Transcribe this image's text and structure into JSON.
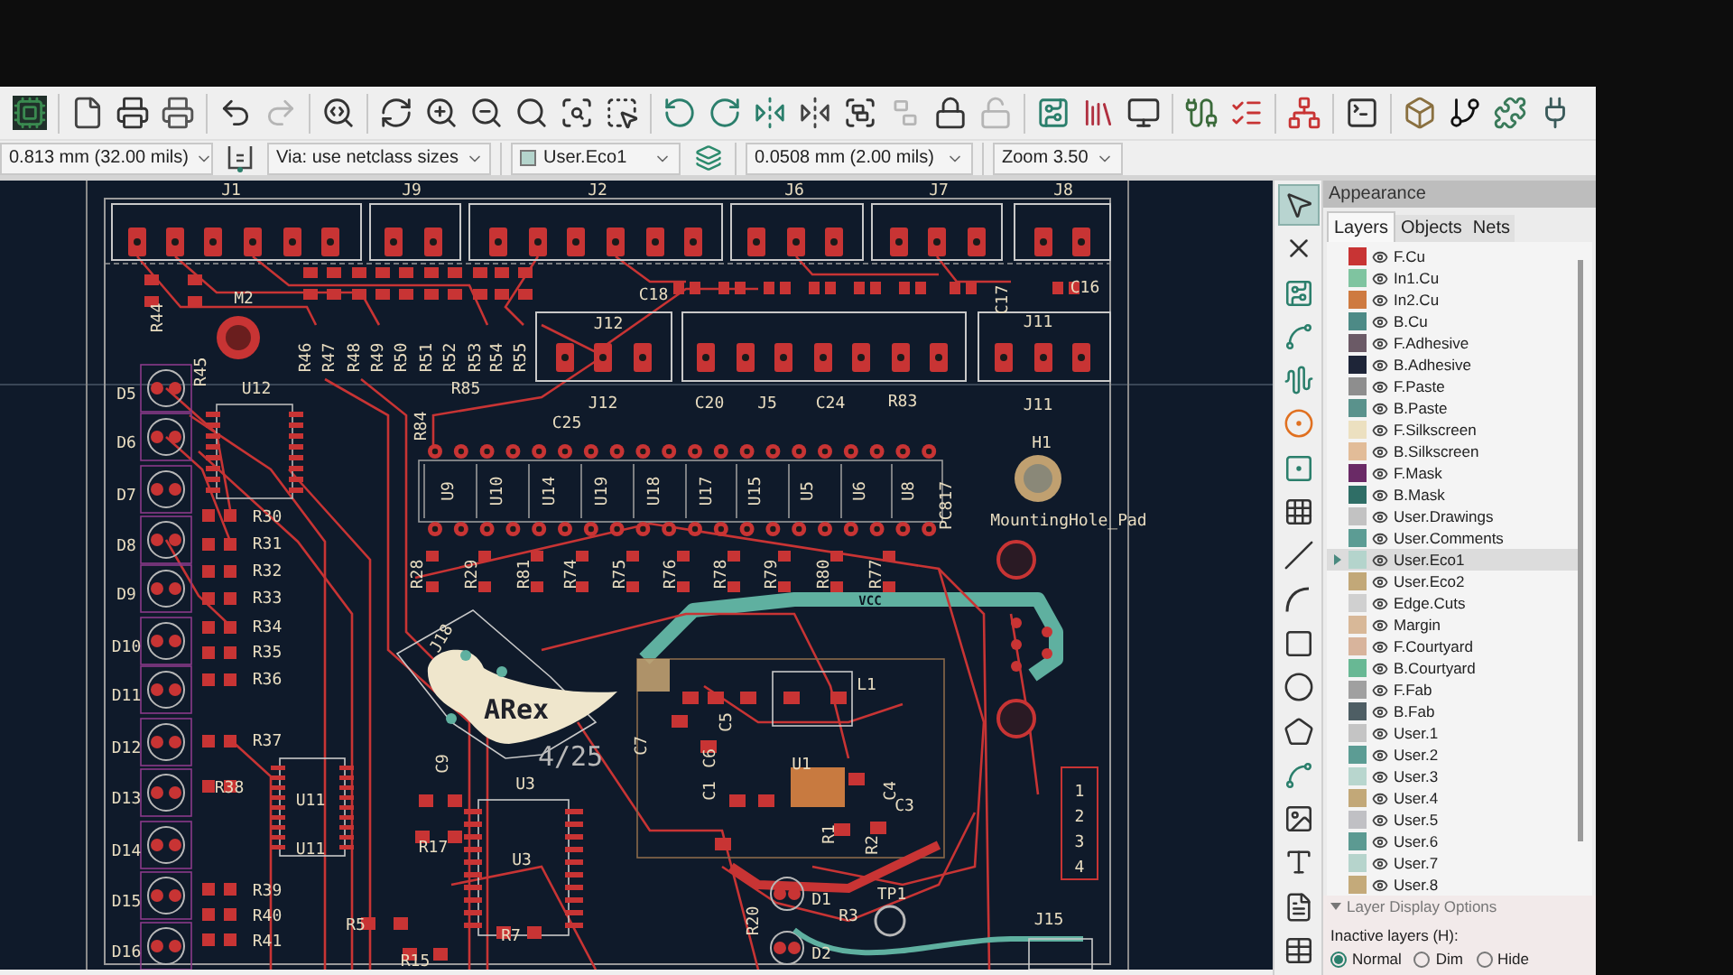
{
  "top_toolbar": [
    {
      "kind": "board-setup",
      "disabled": false
    },
    {
      "kind": "page",
      "disabled": false
    },
    {
      "kind": "print",
      "disabled": false
    },
    {
      "kind": "plot",
      "disabled": false
    },
    {
      "kind": "undo",
      "disabled": false
    },
    {
      "kind": "redo",
      "disabled": true
    },
    {
      "kind": "find",
      "disabled": false
    },
    {
      "kind": "redraw",
      "disabled": false
    },
    {
      "kind": "zoom-in",
      "disabled": false
    },
    {
      "kind": "zoom-out",
      "disabled": false
    },
    {
      "kind": "zoom-fit",
      "disabled": false
    },
    {
      "kind": "zoom-objects",
      "disabled": false
    },
    {
      "kind": "zoom-select",
      "disabled": false
    },
    {
      "kind": "rotate-ccw",
      "disabled": false
    },
    {
      "kind": "rotate-cw",
      "disabled": false
    },
    {
      "kind": "flip",
      "disabled": false
    },
    {
      "kind": "mirror",
      "disabled": false
    },
    {
      "kind": "group",
      "disabled": false
    },
    {
      "kind": "ungroup",
      "disabled": true
    },
    {
      "kind": "lock",
      "disabled": false
    },
    {
      "kind": "unlock",
      "disabled": true
    },
    {
      "kind": "footprint-editor",
      "disabled": false
    },
    {
      "kind": "footprint-browser",
      "disabled": false
    },
    {
      "kind": "board-stackup",
      "disabled": false
    },
    {
      "kind": "update-pcb",
      "disabled": false
    },
    {
      "kind": "drc",
      "disabled": false
    },
    {
      "kind": "net-inspector",
      "disabled": false
    },
    {
      "kind": "console",
      "disabled": false
    },
    {
      "kind": "viewer-3d",
      "disabled": false
    },
    {
      "kind": "git",
      "disabled": false
    },
    {
      "kind": "plugin",
      "disabled": false
    },
    {
      "kind": "export",
      "disabled": false
    }
  ],
  "options_bar": {
    "track_width": "0.813 mm (32.00 mils)",
    "via_size": "Via: use netclass sizes",
    "layer": {
      "name": "User.Eco1",
      "color": "#b4d4cc"
    },
    "grid": "0.0508 mm (2.00 mils)",
    "zoom": "Zoom 3.50"
  },
  "right_toolbar": [
    {
      "kind": "select",
      "selected": true
    },
    {
      "kind": "ratsnest",
      "selected": false
    },
    {
      "kind": "footprint",
      "selected": false
    },
    {
      "kind": "route",
      "selected": false
    },
    {
      "kind": "tune",
      "selected": false
    },
    {
      "kind": "via",
      "selected": false
    },
    {
      "kind": "pad",
      "selected": false
    },
    {
      "kind": "zone",
      "selected": false
    },
    {
      "kind": "line",
      "selected": false
    },
    {
      "kind": "arc",
      "selected": false
    },
    {
      "kind": "rectangle",
      "selected": false
    },
    {
      "kind": "circle",
      "selected": false
    },
    {
      "kind": "polygon",
      "selected": false
    },
    {
      "kind": "bezier",
      "selected": false
    },
    {
      "kind": "image",
      "selected": false
    },
    {
      "kind": "text",
      "selected": false
    },
    {
      "kind": "textbox",
      "selected": false
    },
    {
      "kind": "table",
      "selected": false
    }
  ],
  "appearance": {
    "title": "Appearance",
    "tabs": [
      {
        "label": "Layers",
        "selected": true
      },
      {
        "label": "Objects",
        "selected": false
      },
      {
        "label": "Nets",
        "selected": false
      }
    ],
    "layers": [
      {
        "name": "F.Cu",
        "color": "#c83434",
        "selected": false
      },
      {
        "name": "In1.Cu",
        "color": "#7fc4a0",
        "selected": false
      },
      {
        "name": "In2.Cu",
        "color": "#ce7a40",
        "selected": false
      },
      {
        "name": "B.Cu",
        "color": "#4d8a86",
        "selected": false
      },
      {
        "name": "F.Adhesive",
        "color": "#6b5a66",
        "selected": false
      },
      {
        "name": "B.Adhesive",
        "color": "#1e2538",
        "selected": false
      },
      {
        "name": "F.Paste",
        "color": "#8e8e8e",
        "selected": false
      },
      {
        "name": "B.Paste",
        "color": "#5a928c",
        "selected": false
      },
      {
        "name": "F.Silkscreen",
        "color": "#ece0c0",
        "selected": false
      },
      {
        "name": "B.Silkscreen",
        "color": "#e2bc98",
        "selected": false
      },
      {
        "name": "F.Mask",
        "color": "#6a2a66",
        "selected": false
      },
      {
        "name": "B.Mask",
        "color": "#2f6e66",
        "selected": false
      },
      {
        "name": "User.Drawings",
        "color": "#c2c2c2",
        "selected": false
      },
      {
        "name": "User.Comments",
        "color": "#5c9c94",
        "selected": false
      },
      {
        "name": "User.Eco1",
        "color": "#b4d4cc",
        "selected": true
      },
      {
        "name": "User.Eco2",
        "color": "#c2a878",
        "selected": false
      },
      {
        "name": "Edge.Cuts",
        "color": "#d0d0d0",
        "selected": false
      },
      {
        "name": "Margin",
        "color": "#d8b898",
        "selected": false
      },
      {
        "name": "F.Courtyard",
        "color": "#d8b49c",
        "selected": false
      },
      {
        "name": "B.Courtyard",
        "color": "#68b894",
        "selected": false
      },
      {
        "name": "F.Fab",
        "color": "#a0a0a0",
        "selected": false
      },
      {
        "name": "B.Fab",
        "color": "#4e5e64",
        "selected": false
      },
      {
        "name": "User.1",
        "color": "#c4c4c4",
        "selected": false
      },
      {
        "name": "User.2",
        "color": "#5c9c94",
        "selected": false
      },
      {
        "name": "User.3",
        "color": "#b8d6ce",
        "selected": false
      },
      {
        "name": "User.4",
        "color": "#c2a878",
        "selected": false
      },
      {
        "name": "User.5",
        "color": "#c0c0c4",
        "selected": false
      },
      {
        "name": "User.6",
        "color": "#5c9a92",
        "selected": false
      },
      {
        "name": "User.7",
        "color": "#b6d4cc",
        "selected": false
      },
      {
        "name": "User.8",
        "color": "#c4aa7a",
        "selected": false
      }
    ],
    "display_options": {
      "title": "Layer Display Options",
      "inactive_label": "Inactive layers (H):",
      "options": [
        {
          "label": "Normal",
          "selected": true
        },
        {
          "label": "Dim",
          "selected": false
        },
        {
          "label": "Hide",
          "selected": false
        }
      ]
    }
  },
  "board": {
    "labels": [
      {
        "text": "J1",
        "kind": "ref"
      },
      {
        "text": "J9",
        "kind": "ref"
      },
      {
        "text": "J2",
        "kind": "ref"
      },
      {
        "text": "J6",
        "kind": "ref"
      },
      {
        "text": "J7",
        "kind": "ref"
      },
      {
        "text": "J8",
        "kind": "ref"
      },
      {
        "text": "M2",
        "kind": "ref"
      },
      {
        "text": "R44",
        "kind": "ref"
      },
      {
        "text": "R45",
        "kind": "ref"
      },
      {
        "text": "R46",
        "kind": "ref"
      },
      {
        "text": "R47",
        "kind": "ref"
      },
      {
        "text": "R48",
        "kind": "ref"
      },
      {
        "text": "R49",
        "kind": "ref"
      },
      {
        "text": "R50",
        "kind": "ref"
      },
      {
        "text": "R51",
        "kind": "ref"
      },
      {
        "text": "R52",
        "kind": "ref"
      },
      {
        "text": "R53",
        "kind": "ref"
      },
      {
        "text": "R54",
        "kind": "ref"
      },
      {
        "text": "R55",
        "kind": "ref"
      },
      {
        "text": "C18",
        "kind": "ref"
      },
      {
        "text": "C16",
        "kind": "ref"
      },
      {
        "text": "C17",
        "kind": "ref"
      },
      {
        "text": "J12",
        "kind": "ref"
      },
      {
        "text": "J11",
        "kind": "ref"
      },
      {
        "text": "R85",
        "kind": "ref"
      },
      {
        "text": "R84",
        "kind": "ref"
      },
      {
        "text": "J12",
        "kind": "ref"
      },
      {
        "text": "C20",
        "kind": "ref"
      },
      {
        "text": "J5",
        "kind": "ref"
      },
      {
        "text": "C24",
        "kind": "ref"
      },
      {
        "text": "R83",
        "kind": "ref"
      },
      {
        "text": "J11",
        "kind": "ref"
      },
      {
        "text": "C25",
        "kind": "ref"
      },
      {
        "text": "U12",
        "kind": "ref"
      },
      {
        "text": "H1",
        "kind": "ref"
      },
      {
        "text": "MountingHole_Pad",
        "kind": "ref"
      },
      {
        "text": "D5",
        "kind": "ref"
      },
      {
        "text": "D6",
        "kind": "ref"
      },
      {
        "text": "D7",
        "kind": "ref"
      },
      {
        "text": "D8",
        "kind": "ref"
      },
      {
        "text": "D9",
        "kind": "ref"
      },
      {
        "text": "D10",
        "kind": "ref"
      },
      {
        "text": "D11",
        "kind": "ref"
      },
      {
        "text": "D12",
        "kind": "ref"
      },
      {
        "text": "D13",
        "kind": "ref"
      },
      {
        "text": "D14",
        "kind": "ref"
      },
      {
        "text": "D15",
        "kind": "ref"
      },
      {
        "text": "D16",
        "kind": "ref"
      },
      {
        "text": "R30",
        "kind": "ref"
      },
      {
        "text": "R31",
        "kind": "ref"
      },
      {
        "text": "R32",
        "kind": "ref"
      },
      {
        "text": "R33",
        "kind": "ref"
      },
      {
        "text": "R34",
        "kind": "ref"
      },
      {
        "text": "R35",
        "kind": "ref"
      },
      {
        "text": "R36",
        "kind": "ref"
      },
      {
        "text": "R37",
        "kind": "ref"
      },
      {
        "text": "R38",
        "kind": "ref"
      },
      {
        "text": "R39",
        "kind": "ref"
      },
      {
        "text": "R40",
        "kind": "ref"
      },
      {
        "text": "R41",
        "kind": "ref"
      },
      {
        "text": "U9",
        "kind": "ref"
      },
      {
        "text": "U10",
        "kind": "ref"
      },
      {
        "text": "U14",
        "kind": "ref"
      },
      {
        "text": "U19",
        "kind": "ref"
      },
      {
        "text": "U18",
        "kind": "ref"
      },
      {
        "text": "U17",
        "kind": "ref"
      },
      {
        "text": "U15",
        "kind": "ref"
      },
      {
        "text": "U5",
        "kind": "ref"
      },
      {
        "text": "U6",
        "kind": "ref"
      },
      {
        "text": "U8",
        "kind": "ref"
      },
      {
        "text": "PC817",
        "kind": "ref"
      },
      {
        "text": "R28",
        "kind": "ref"
      },
      {
        "text": "R29",
        "kind": "ref"
      },
      {
        "text": "R81",
        "kind": "ref"
      },
      {
        "text": "R74",
        "kind": "ref"
      },
      {
        "text": "R75",
        "kind": "ref"
      },
      {
        "text": "R76",
        "kind": "ref"
      },
      {
        "text": "R78",
        "kind": "ref"
      },
      {
        "text": "R79",
        "kind": "ref"
      },
      {
        "text": "R80",
        "kind": "ref"
      },
      {
        "text": "R77",
        "kind": "ref"
      },
      {
        "text": "VCC",
        "kind": "net"
      },
      {
        "text": "J18",
        "kind": "ref"
      },
      {
        "text": "ARex",
        "kind": "logo"
      },
      {
        "text": "4/25",
        "kind": "big"
      },
      {
        "text": "U3",
        "kind": "ref"
      },
      {
        "text": "U3",
        "kind": "ref"
      },
      {
        "text": "U11",
        "kind": "ref"
      },
      {
        "text": "U11",
        "kind": "ref"
      },
      {
        "text": "C9",
        "kind": "ref"
      },
      {
        "text": "R17",
        "kind": "ref"
      },
      {
        "text": "U1",
        "kind": "ref"
      },
      {
        "text": "L1",
        "kind": "ref"
      },
      {
        "text": "C3",
        "kind": "ref"
      },
      {
        "text": "C4",
        "kind": "ref"
      },
      {
        "text": "C7",
        "kind": "ref"
      },
      {
        "text": "C5",
        "kind": "ref"
      },
      {
        "text": "C6",
        "kind": "ref"
      },
      {
        "text": "C1",
        "kind": "ref"
      },
      {
        "text": "R5",
        "kind": "ref"
      },
      {
        "text": "R7",
        "kind": "ref"
      },
      {
        "text": "R15",
        "kind": "ref"
      },
      {
        "text": "R1",
        "kind": "ref"
      },
      {
        "text": "R2",
        "kind": "ref"
      },
      {
        "text": "D1",
        "kind": "ref"
      },
      {
        "text": "D2",
        "kind": "ref"
      },
      {
        "text": "R3",
        "kind": "ref"
      },
      {
        "text": "TP1",
        "kind": "ref"
      },
      {
        "text": "J15",
        "kind": "ref"
      },
      {
        "text": "R20",
        "kind": "ref"
      },
      {
        "text": "1",
        "kind": "ref"
      },
      {
        "text": "2",
        "kind": "ref"
      },
      {
        "text": "3",
        "kind": "ref"
      },
      {
        "text": "4",
        "kind": "ref"
      }
    ]
  }
}
